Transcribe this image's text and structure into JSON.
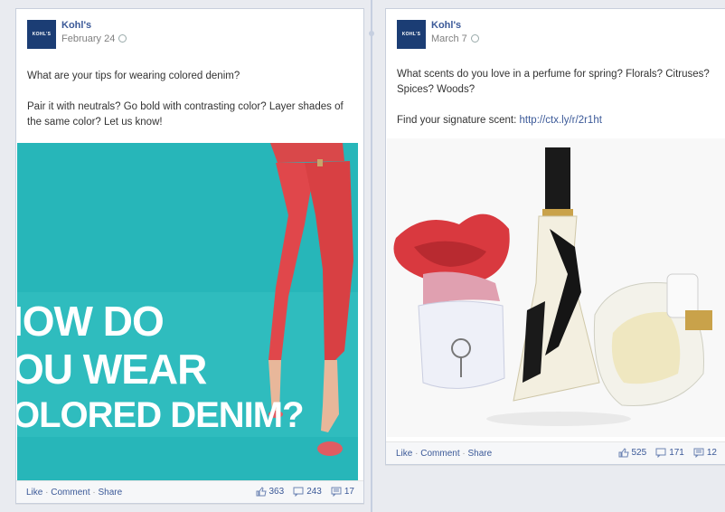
{
  "posts": [
    {
      "author": "Kohl's",
      "logo_text": "KOHL'S",
      "date": "February 24",
      "paragraphs": [
        "What are your tips for wearing colored denim?",
        "Pair it with neutrals? Go bold with contrasting color? Layer shades of the same color? Let us know!"
      ],
      "image_text": [
        "IOW DO",
        "OU WEAR",
        "OLORED DENIM?"
      ],
      "actions": {
        "like": "Like",
        "comment": "Comment",
        "share": "Share"
      },
      "stats": {
        "likes": "363",
        "comments": "243",
        "shares": "17"
      }
    },
    {
      "author": "Kohl's",
      "logo_text": "KOHL'S",
      "date": "March 7",
      "paragraphs": [
        "What scents do you love in a perfume for spring? Florals? Citruses? Spices? Woods?"
      ],
      "link_prefix": "Find your signature scent: ",
      "link": "http://ctx.ly/r/2r1ht",
      "actions": {
        "like": "Like",
        "comment": "Comment",
        "share": "Share"
      },
      "stats": {
        "likes": "525",
        "comments": "171",
        "shares": "12"
      }
    }
  ],
  "colors": {
    "link": "#3b5998",
    "teal": "#27b6b9",
    "denim_red": "#e0474b",
    "logo": "#1b3d74"
  },
  "icons": [
    "globe-icon",
    "thumbs-up-icon",
    "comment-icon",
    "share-icon"
  ]
}
